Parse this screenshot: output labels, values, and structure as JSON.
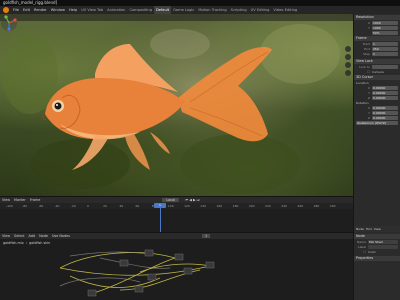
{
  "window": {
    "title": "goldfish_model_rigg.blend]"
  },
  "topbar": {
    "menus": [
      "File",
      "Edit",
      "Render",
      "Window",
      "Help"
    ],
    "workspaces": [
      {
        "label": "UV View Tab",
        "active": false
      },
      {
        "label": "Animation",
        "active": false
      },
      {
        "label": "Compositing",
        "active": false
      },
      {
        "label": "Default",
        "active": true
      },
      {
        "label": "Game Logic",
        "active": false
      },
      {
        "label": "Motion Tracking",
        "active": false
      },
      {
        "label": "Scripting",
        "active": false
      },
      {
        "label": "UV Editing",
        "active": false
      },
      {
        "label": "Video Editing",
        "active": false
      }
    ]
  },
  "properties": {
    "resolution": {
      "header": "Resolution",
      "x_label": "X",
      "x": "1920",
      "y_label": "Y",
      "y": "1080",
      "percent": "50%"
    },
    "frame": {
      "header": "Frame",
      "start_label": "Start",
      "start": "1",
      "end_label": "End",
      "end": "250",
      "step_label": "Step",
      "step": "1"
    },
    "view": {
      "header": "View Lock",
      "lock_label": "Lock to",
      "camera_label": "Camera"
    },
    "cursor3d": {
      "header": "3D Cursor",
      "location_label": "Location",
      "x_label": "X",
      "x": "0.00000",
      "y_label": "Y",
      "y": "0.00000",
      "z_label": "Z",
      "z": "0.00000",
      "rotation_label": "Rotation",
      "rx": "0.00000",
      "ry": "0.00000",
      "rz": "0.00000",
      "mode": "Quaternion (WXYZ)"
    }
  },
  "timeline": {
    "menus": [
      "View",
      "Marker",
      "Frame"
    ],
    "mode": "Local",
    "ruler": [
      "-100",
      "-80",
      "-60",
      "-40",
      "-20",
      "0",
      "20",
      "40",
      "60",
      "80",
      "100",
      "120",
      "140",
      "160",
      "180",
      "200",
      "220",
      "240",
      "260",
      "280",
      "300"
    ],
    "current_frame": "1"
  },
  "node_editor": {
    "menus": [
      "View",
      "Select",
      "Add",
      "Node"
    ],
    "use_nodes": "Use Nodes",
    "breadcrumb": [
      "goldfish.mix",
      "goldfish skin"
    ],
    "frame": "1"
  },
  "side_panel": {
    "tabs": [
      "Node",
      "Tool",
      "View"
    ],
    "node_header": "Node",
    "name_label": "Name",
    "name": "Mix Shad",
    "label_label": "Label",
    "color_label": "Color",
    "properties_header": "Properties"
  },
  "colors": {
    "accent": "#4a78c7",
    "fish_orange": "#e8813a",
    "link_yellow": "#d4c84a"
  }
}
